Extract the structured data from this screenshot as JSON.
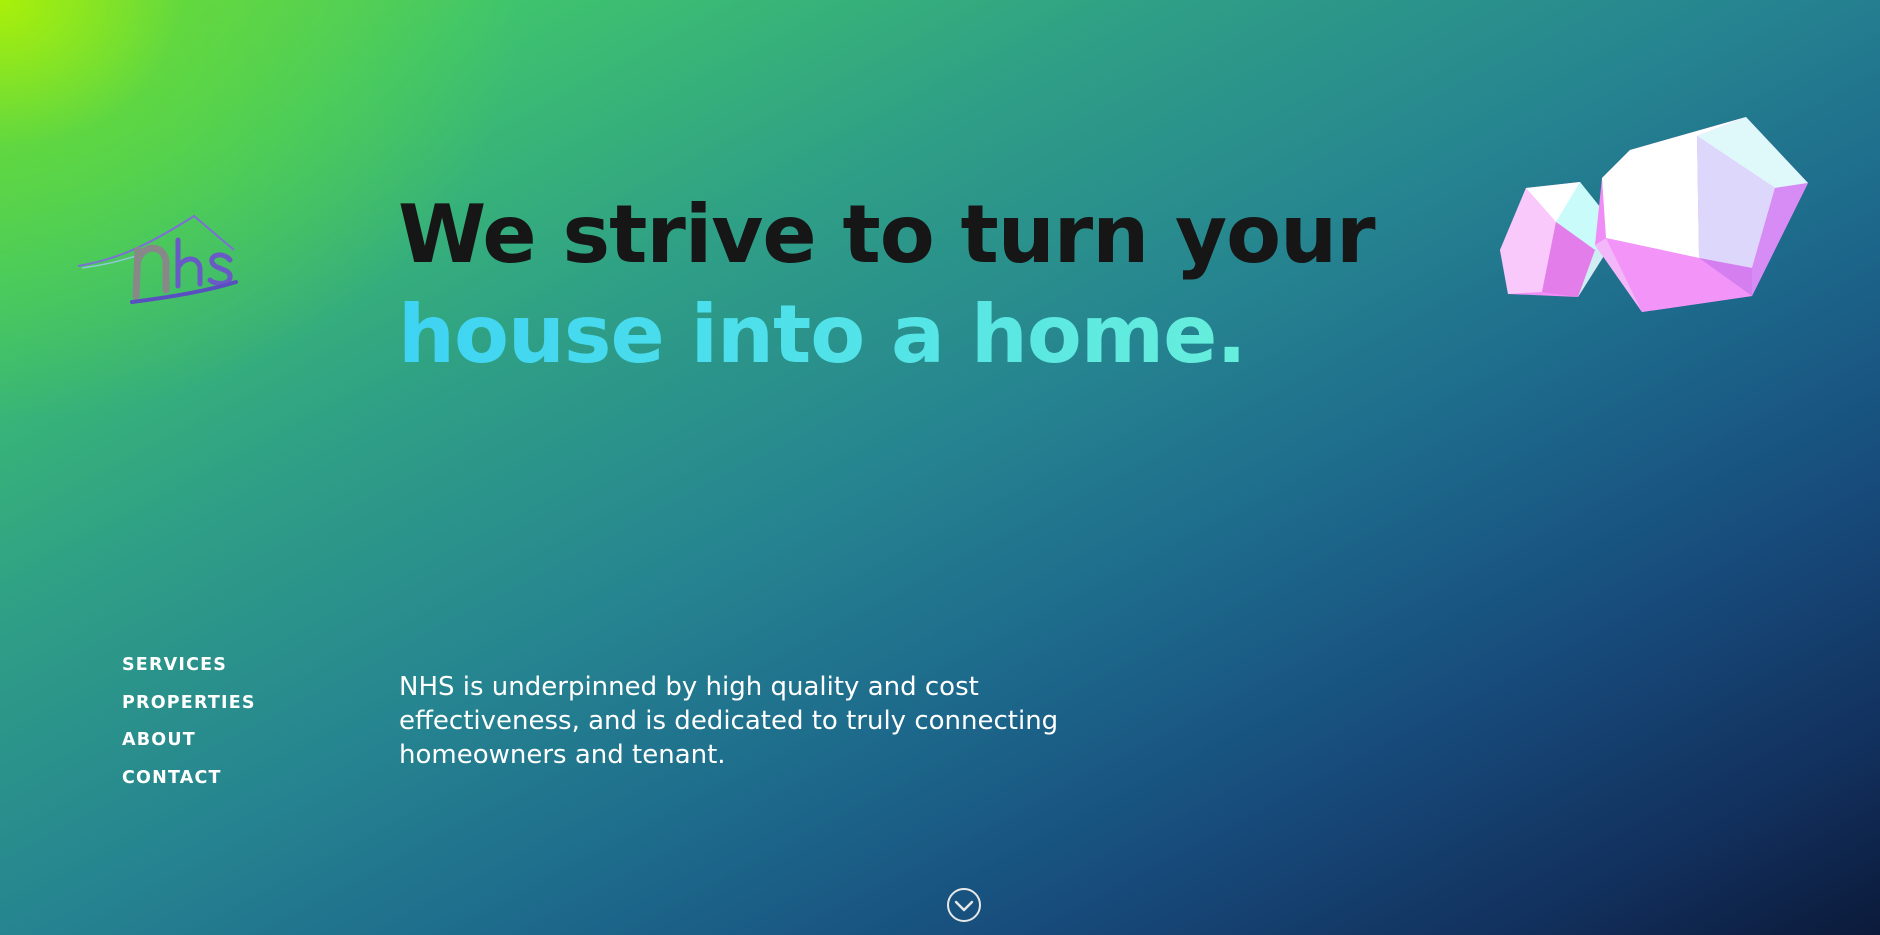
{
  "brand": {
    "logo_text": "nhs",
    "logo_icon": "nhs-house-logo"
  },
  "hero": {
    "headline_line1": "We strive to turn your",
    "headline_line2": "house into a home.",
    "tagline": "NHS is underpinned by high quality and cost effectiveness, and is dedicated to truly connecting homeowners and tenant."
  },
  "nav": {
    "items": [
      {
        "label": "SERVICES"
      },
      {
        "label": "PROPERTIES"
      },
      {
        "label": "ABOUT"
      },
      {
        "label": "CONTACT"
      }
    ]
  },
  "decoration": {
    "gems_icon": "crystal-gems-graphic"
  },
  "scroll": {
    "icon": "chevron-down-circle-icon"
  },
  "colors": {
    "headline_dark": "#161616",
    "headline_accent_start": "#3ed3f3",
    "headline_accent_end": "#6ef2d7",
    "text_light": "#ffffff"
  }
}
